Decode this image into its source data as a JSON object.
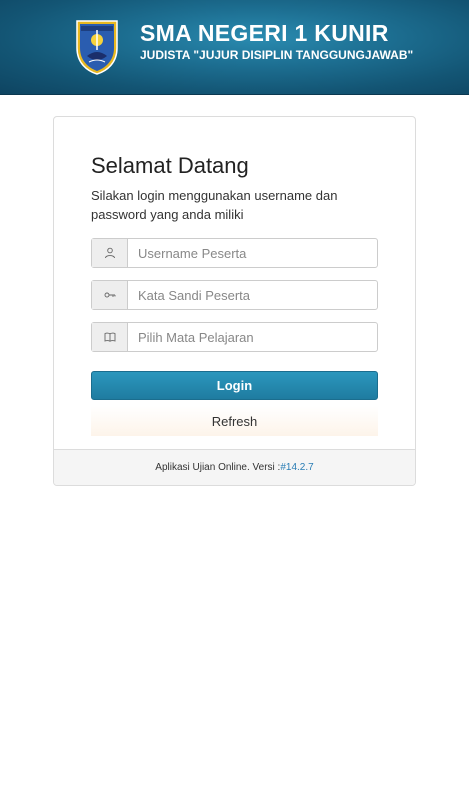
{
  "header": {
    "school_name": "SMA NEGERI 1 KUNIR",
    "motto": "JUDISTA \"JUJUR DISIPLIN TANGGUNGJAWAB\""
  },
  "login": {
    "title": "Selamat Datang",
    "subtitle": "Silakan login menggunakan username dan password yang anda miliki",
    "username_placeholder": "Username Peserta",
    "password_placeholder": "Kata Sandi Peserta",
    "subject_placeholder": "Pilih Mata Pelajaran",
    "login_label": "Login",
    "refresh_label": "Refresh"
  },
  "footer": {
    "text": "Aplikasi Ujian Online. Versi :",
    "version": "#14.2.7"
  },
  "icons": {
    "username": "user-icon",
    "password": "key-icon",
    "subject": "book-icon"
  },
  "colors": {
    "header": "#1d6f92",
    "login_button": "#2189ae",
    "version_link": "#2a7db5"
  }
}
